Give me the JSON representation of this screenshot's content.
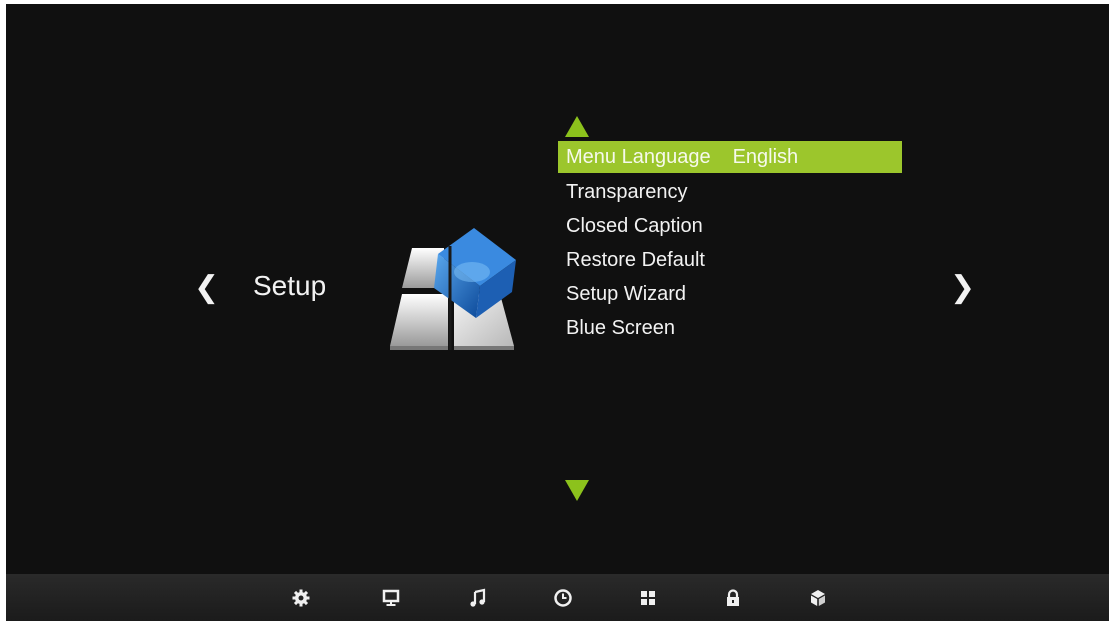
{
  "section": {
    "title": "Setup",
    "left_arrow": "❮",
    "right_arrow": "❯"
  },
  "menu": {
    "items": [
      {
        "label": "Menu Language",
        "value": "English",
        "selected": true
      },
      {
        "label": "Transparency"
      },
      {
        "label": "Closed Caption"
      },
      {
        "label": "Restore Default"
      },
      {
        "label": "Setup Wizard"
      },
      {
        "label": "Blue Screen"
      }
    ]
  },
  "bottom_bar": {
    "icons": [
      "gear-icon",
      "monitor-icon",
      "music-icon",
      "clock-icon",
      "grid-icon",
      "lock-icon",
      "cube-icon"
    ]
  },
  "colors": {
    "accent": "#9cc62c",
    "background": "#101010",
    "text": "#f2f2f2"
  }
}
